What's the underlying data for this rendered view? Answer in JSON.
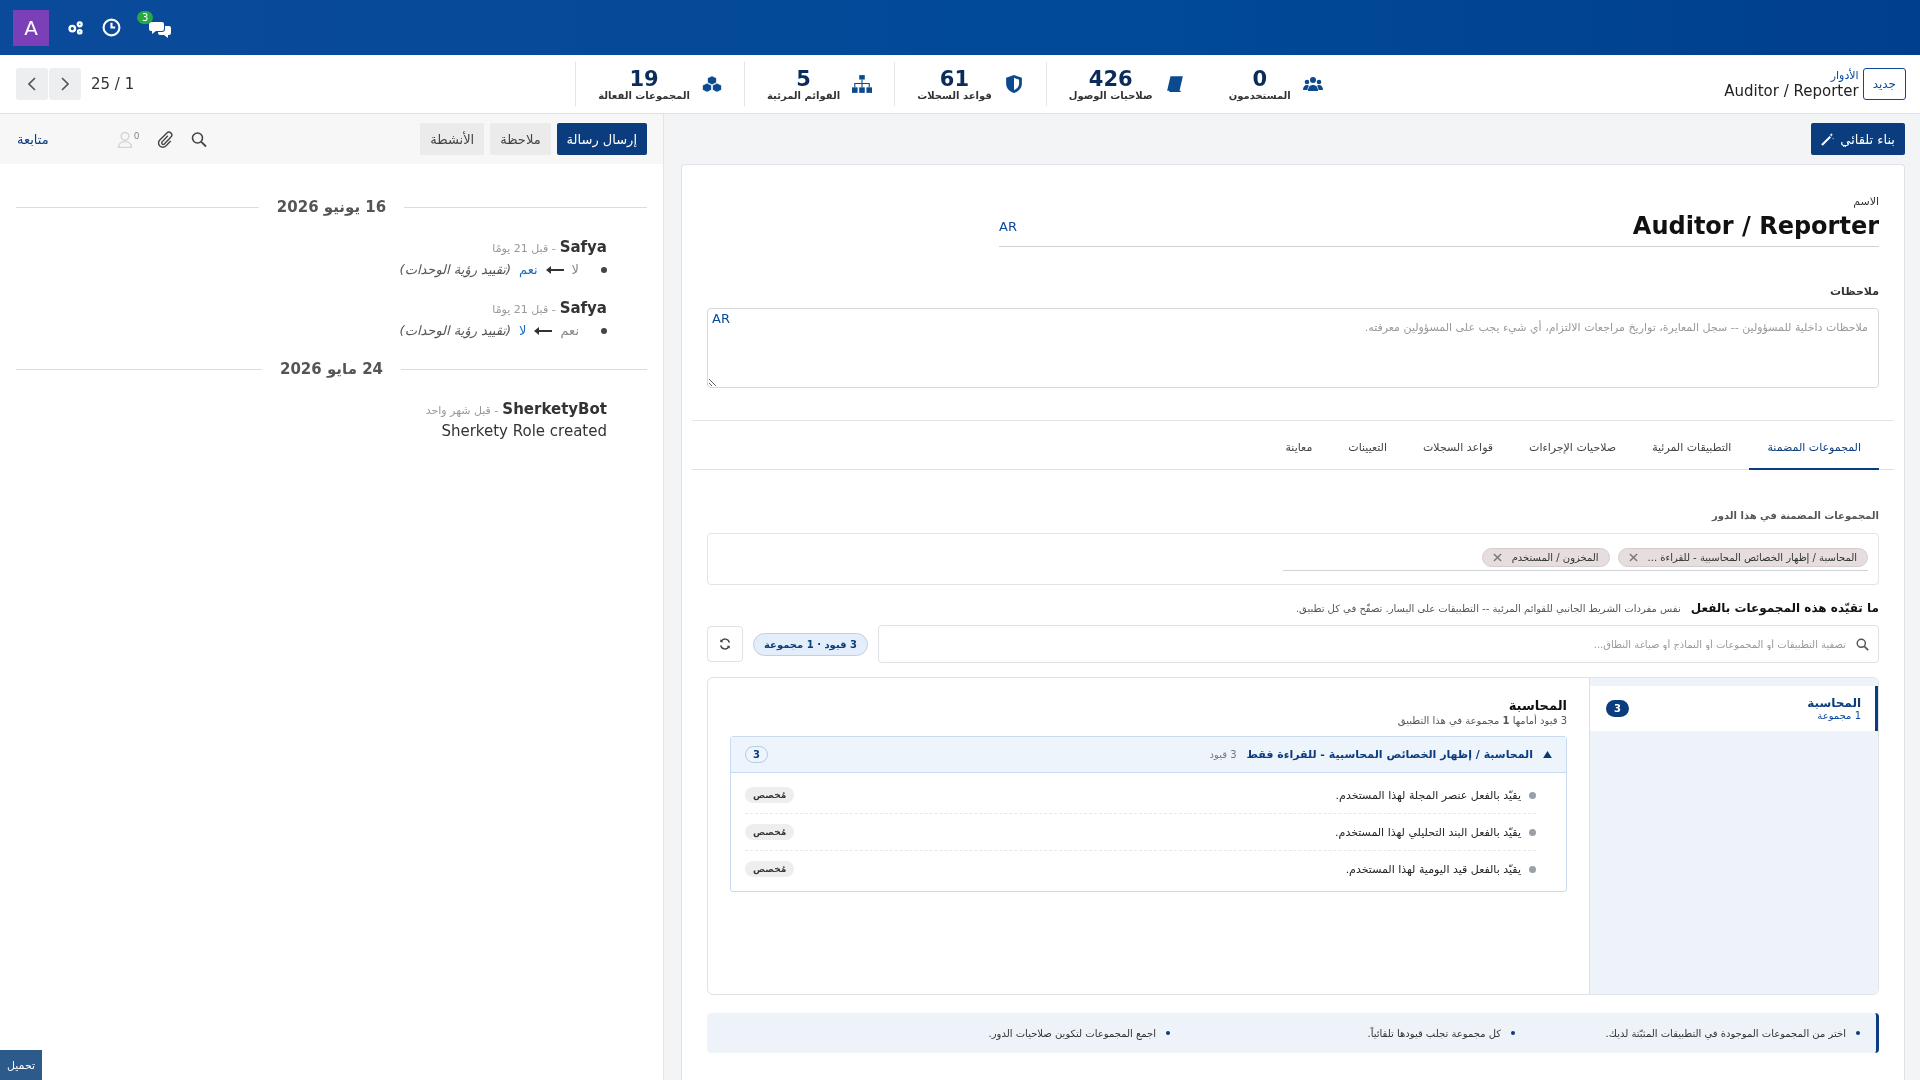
{
  "navbar": {
    "avatar": "A",
    "chat_badge": "3"
  },
  "pager": {
    "value": "25 / 1"
  },
  "stats": [
    {
      "kind": "users",
      "value": "0",
      "label": "المستخدمون"
    },
    {
      "kind": "access",
      "value": "426",
      "label": "صلاحيات الوصول"
    },
    {
      "kind": "rules",
      "value": "61",
      "label": "قواعد السجلات"
    },
    {
      "kind": "menus",
      "value": "5",
      "label": "القوائم المرئية"
    },
    {
      "kind": "groups",
      "value": "19",
      "label": "المجموعات الفعالة"
    }
  ],
  "breadcrumb": {
    "parent": "الأدوار",
    "current": "Auditor / Reporter",
    "new_button": "جديد"
  },
  "auto_build_button": "بناء تلقائي",
  "chatter": {
    "buttons": [
      {
        "label": "إرسال رسالة",
        "selected": true
      },
      {
        "label": "ملاحظة",
        "selected": false
      },
      {
        "label": "الأنشطة",
        "selected": false
      }
    ],
    "follower_count": "0",
    "follow": "متابعة",
    "days": [
      {
        "date": "16 يونيو 2026",
        "messages": [
          {
            "kind": "tracking",
            "author": "Safya",
            "time": "- قبل 21 يومًا",
            "old": "لا",
            "new": "نعم",
            "field": "(تقييد رؤية الوحدات)"
          },
          {
            "kind": "tracking",
            "author": "Safya",
            "time": "- قبل 21 يومًا",
            "old": "نعم",
            "new": "لا",
            "field": "(تقييد رؤية الوحدات)"
          }
        ]
      },
      {
        "date": "24 مايو 2026",
        "messages": [
          {
            "kind": "text",
            "author": "SherketyBot",
            "time": "- قبل شهر واحد",
            "body": "Sherkety Role created"
          }
        ]
      }
    ]
  },
  "form": {
    "name": {
      "label": "الاسم",
      "value": "Auditor / Reporter",
      "lang": "AR"
    },
    "notes": {
      "label": "ملاحظات",
      "placeholder": "ملاحظات داخلية للمسؤولين -- سجل المعايرة، تواريخ مراجعات الالتزام، أي شيء يجب على المسؤولين معرفته.",
      "lang": "AR"
    },
    "tabs": [
      {
        "label": "المجموعات المضمنة",
        "selected": true
      },
      {
        "label": "التطبيقات المرئية",
        "selected": false
      },
      {
        "label": "صلاحيات الإجراءات",
        "selected": false
      },
      {
        "label": "قواعد السجلات",
        "selected": false
      },
      {
        "label": "التعيينات",
        "selected": false
      },
      {
        "label": "معاينة",
        "selected": false
      }
    ],
    "groups_label": "المجموعات المضمنة في هذا الدور",
    "tags": [
      "المحاسبة / إظهار الخصائص المحاسبية - للقراءة ...",
      "المخزون / المستخدم"
    ],
    "effect": {
      "title": "ما تقيّده هذه المجموعات بالفعل",
      "description": "نفس مفردات الشريط الجانبي للقوائم المرئية -- التطبيقات على اليسار. تصفّح في كل تطبيق.",
      "search_placeholder": "تصفية التطبيقات أو المجموعات أو النماذج أو صياغة النطاق...",
      "summary": "3 قيود · 1 مجموعة"
    },
    "apps": [
      {
        "name": "المحاسبة",
        "sub": "1 مجموعة",
        "count": "3",
        "selected": true
      }
    ],
    "detail": {
      "title": "المحاسبة",
      "subtitle": "3 قيود أمامها **1** مجموعة في هذا التطبيق",
      "group": {
        "title": "المحاسبة / إظهار الخصائص المحاسبية - للقراءة فقط",
        "count_text": "3 قيود",
        "count": "3",
        "expanded": true,
        "rules": [
          {
            "text": "يقيّد بالفعل عنصر المجلة لهذا المستخدم.",
            "tag": "مُخصص"
          },
          {
            "text": "يقيّد بالفعل البند التحليلي لهذا المستخدم.",
            "tag": "مُخصص"
          },
          {
            "text": "يقيّد بالفعل قيد اليومية لهذا المستخدم.",
            "tag": "مُخصص"
          }
        ]
      }
    },
    "tips": [
      "اختر من المجموعات الموجودة في التطبيقات المثبّتة لديك.",
      "كل مجموعة تجلب قيودها تلقائياً.",
      "اجمع المجموعات لتكوين صلاحيات الدور."
    ]
  },
  "download_button": "تحميل"
}
